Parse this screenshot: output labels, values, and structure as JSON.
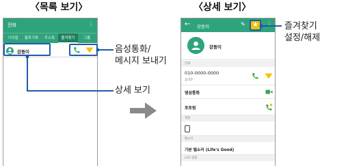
{
  "captions": {
    "list_view": "〈목록 보기〉",
    "detail_view": "〈상세 보기〉"
  },
  "list_screen": {
    "app_title": "전화",
    "menu_icon": "more-vert-icon",
    "tabs": [
      {
        "label": "다이얼"
      },
      {
        "label": "통화기록"
      },
      {
        "label": "주소록"
      },
      {
        "label": "즐겨찾기"
      },
      {
        "label": "그룹"
      }
    ],
    "active_tab": "즐겨찾기",
    "contact": {
      "name": "강동이"
    },
    "colors": {
      "primary_green": "#2fa37c",
      "highlight_blue": "#1e5aa8",
      "favorite_yellow": "#f2c200"
    }
  },
  "detail_screen": {
    "title": "강동이",
    "profile_name": "강동이",
    "sections": {
      "phone_header": "전화",
      "phone_number": "010-0000-0000",
      "phone_type": "휴대폰",
      "video_call": "영상통화",
      "pottering": "포토링",
      "account_header": "계정",
      "ringtone_header": "벨소리",
      "ringtone_value": "기본 벨소리 (Life's Good)",
      "led_header": "LED 알림"
    }
  },
  "callouts": {
    "call_message_line1": "음성통화/",
    "call_message_line2": "메시지 보내기",
    "detail_view": "상세 보기",
    "favorite_line1": "즐겨찾기",
    "favorite_line2": "설정/해제"
  }
}
